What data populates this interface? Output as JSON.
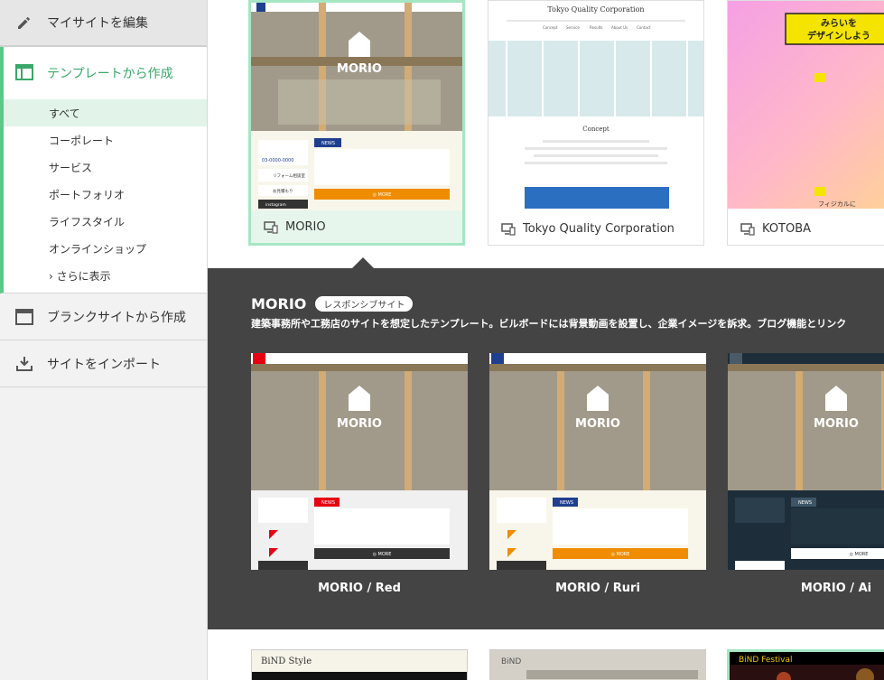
{
  "sidebar": {
    "edit_label": "マイサイトを編集",
    "template_label": "テンプレートから作成",
    "categories": [
      "すべて",
      "コーポレート",
      "サービス",
      "ポートフォリオ",
      "ライフスタイル",
      "オンラインショップ"
    ],
    "more_label": "› さらに表示",
    "blank_label": "ブランクサイトから作成",
    "import_label": "サイトをインポート"
  },
  "templates": [
    {
      "name": "MORIO",
      "selected": true
    },
    {
      "name": "Tokyo Quality Corporation",
      "selected": false
    },
    {
      "name": "KOTOBA",
      "selected": false
    }
  ],
  "thumbs": {
    "morio_logo": "MORIO",
    "news": "NEWS",
    "more": "◎ MORE",
    "reform": "リフォーム相談室",
    "estimate": "お見積もり",
    "instagram": "instagram",
    "phone": "03-0000-0000",
    "tqc_title": "Tokyo Quality Corporation",
    "tqc_nav": [
      "Concept",
      "Service",
      "Results",
      "About Us",
      "Contact"
    ],
    "tqc_concept": "Concept",
    "kotoba_banner_1": "みらいを",
    "kotoba_banner_2": "デザインしよう",
    "kotoba_footer": "フィジカルに",
    "bottom_1": "BiND Style",
    "bottom_2": "BiND",
    "bottom_3": "BiND Festival"
  },
  "detail": {
    "title": "MORIO",
    "badge": "レスポンシブサイト",
    "description": "建築事務所や工務店のサイトを想定したテンプレート。ビルボードには背景動画を設置し、企業イメージを訴求。ブログ機能とリンク",
    "variants": [
      {
        "name": "MORIO / Red",
        "accent": "#e60012"
      },
      {
        "name": "MORIO / Ruri",
        "accent": "#1f3f8f"
      },
      {
        "name": "MORIO / Ai",
        "accent": "#1d2e3a"
      }
    ]
  },
  "colors": {
    "accent_green": "#5bc987",
    "morio_orange": "#f08c00",
    "detail_bg": "#444444"
  }
}
